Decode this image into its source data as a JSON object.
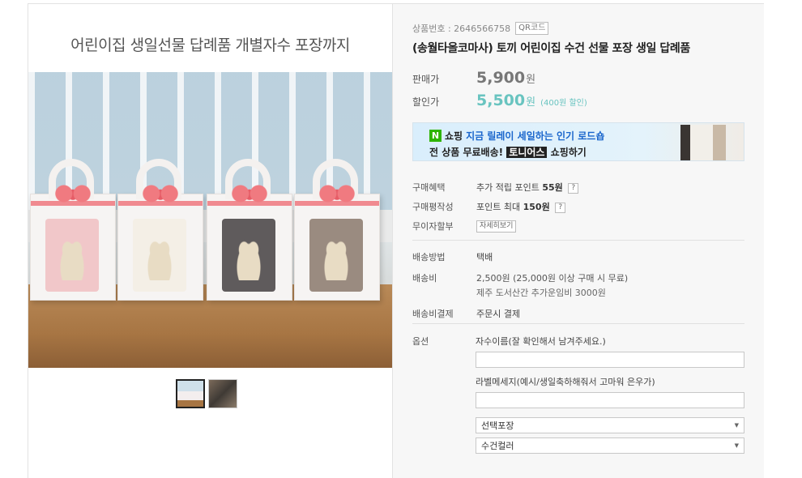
{
  "image": {
    "caption": "어린이집 생일선물 답례품 개별자수 포장까지"
  },
  "thumbnails": [
    {
      "name": "thumb-1",
      "active": true
    },
    {
      "name": "thumb-2",
      "active": false
    }
  ],
  "product": {
    "code_label": "상품번호 : 2646566758",
    "qr_label": "QR코드",
    "title": "(송월타올코마사) 토끼 어린이집 수건 선물 포장 생일 답례품"
  },
  "price": {
    "sale_label": "판매가",
    "sale_value": "5,900",
    "sale_unit": "원",
    "discount_label": "할인가",
    "discount_value": "5,500",
    "discount_unit": "원",
    "discount_note": "(400원 할인)"
  },
  "banner": {
    "shop": "쇼핑",
    "line1_highlight": "지금 릴레이 세일하는 인기 로드숍",
    "line2_prefix": "전 상품 무료배송!",
    "line2_brand": "토니어스",
    "line2_suffix": "쇼핑하기"
  },
  "benefits": {
    "purchase_benefit_label": "구매혜택",
    "purchase_benefit_prefix": "추가 적립 포인트",
    "purchase_benefit_value": "55원",
    "review_label": "구매평작성",
    "review_prefix": "포인트 최대",
    "review_value": "150원",
    "installment_label": "무이자할부",
    "installment_btn": "자세히보기"
  },
  "shipping": {
    "method_label": "배송방법",
    "method_value": "택배",
    "fee_label": "배송비",
    "fee_value": "2,500원 (25,000원 이상 구매 시 무료)",
    "fee_extra": "제주 도서산간 추가운임비 3000원",
    "payment_label": "배송비결제",
    "payment_value": "주문시 결제"
  },
  "options": {
    "label": "옵션",
    "field1_label": "자수이름(잘 확인해서 남겨주세요.)",
    "field1_value": "",
    "field2_label": "라벨메세지(예시/생일축하해줘서 고마워 은우가)",
    "field2_value": "",
    "select1": "선택포장",
    "select2": "수건컬러"
  }
}
